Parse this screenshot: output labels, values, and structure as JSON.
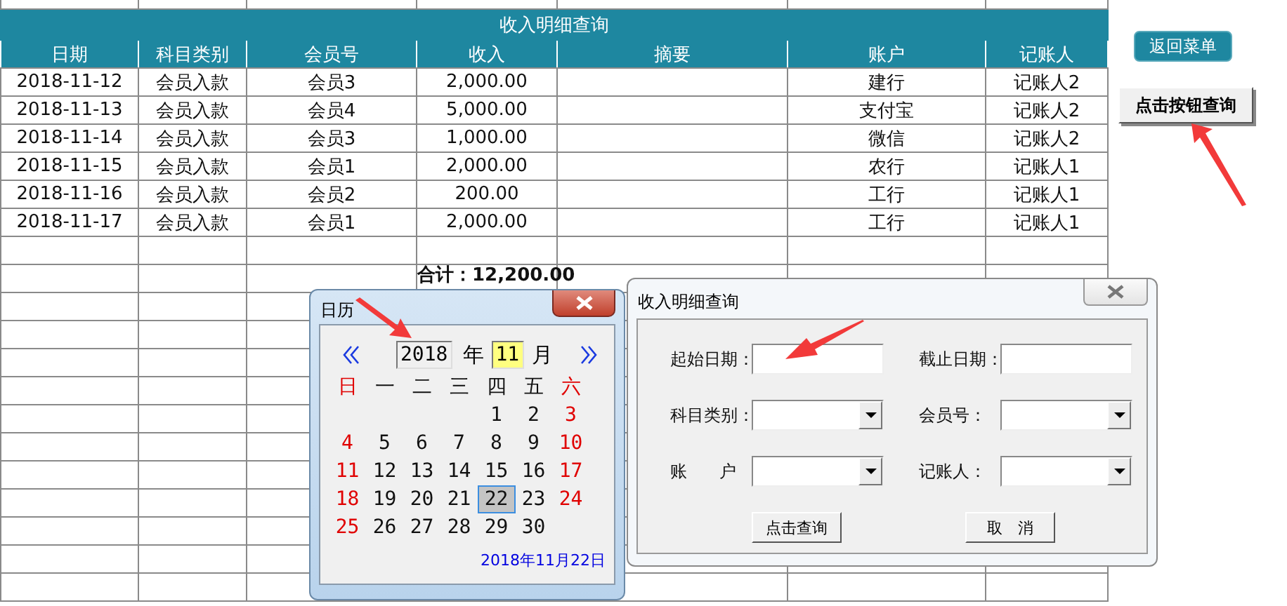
{
  "sheet": {
    "title": "收入明细查询",
    "columns": [
      "日期",
      "科目类别",
      "会员号",
      "收入",
      "摘要",
      "账户",
      "记账人"
    ],
    "rows": [
      [
        "2018-11-12",
        "会员入款",
        "会员3",
        "2,000.00",
        "",
        "建行",
        "记账人2"
      ],
      [
        "2018-11-13",
        "会员入款",
        "会员4",
        "5,000.00",
        "",
        "支付宝",
        "记账人2"
      ],
      [
        "2018-11-14",
        "会员入款",
        "会员3",
        "1,000.00",
        "",
        "微信",
        "记账人2"
      ],
      [
        "2018-11-15",
        "会员入款",
        "会员1",
        "2,000.00",
        "",
        "农行",
        "记账人1"
      ],
      [
        "2018-11-16",
        "会员入款",
        "会员2",
        "200.00",
        "",
        "工行",
        "记账人1"
      ],
      [
        "2018-11-17",
        "会员入款",
        "会员1",
        "2,000.00",
        "",
        "工行",
        "记账人1"
      ]
    ],
    "total": "合计：12,200.00"
  },
  "side_buttons": [
    {
      "label": "返回菜单",
      "kind": "flat"
    },
    {
      "label": "点击按钮查询",
      "kind": "raised"
    }
  ],
  "calendar": {
    "title": "日历",
    "year": "2018",
    "year_unit": "年",
    "month": "11",
    "month_unit": "月",
    "weekdays": [
      {
        "label": "日",
        "weekend": true
      },
      {
        "label": "一",
        "weekend": false
      },
      {
        "label": "二",
        "weekend": false
      },
      {
        "label": "三",
        "weekend": false
      },
      {
        "label": "四",
        "weekend": false
      },
      {
        "label": "五",
        "weekend": false
      },
      {
        "label": "六",
        "weekend": true
      }
    ],
    "days": [
      {
        "day": "1",
        "weekend": false,
        "selected": false
      },
      {
        "day": "2",
        "weekend": false,
        "selected": false
      },
      {
        "day": "3",
        "weekend": true,
        "selected": false
      },
      {
        "day": "4",
        "weekend": true,
        "selected": false
      },
      {
        "day": "5",
        "weekend": false,
        "selected": false
      },
      {
        "day": "6",
        "weekend": false,
        "selected": false
      },
      {
        "day": "7",
        "weekend": false,
        "selected": false
      },
      {
        "day": "8",
        "weekend": false,
        "selected": false
      },
      {
        "day": "9",
        "weekend": false,
        "selected": false
      },
      {
        "day": "10",
        "weekend": true,
        "selected": false
      },
      {
        "day": "11",
        "weekend": true,
        "selected": false
      },
      {
        "day": "12",
        "weekend": false,
        "selected": false
      },
      {
        "day": "13",
        "weekend": false,
        "selected": false
      },
      {
        "day": "14",
        "weekend": false,
        "selected": false
      },
      {
        "day": "15",
        "weekend": false,
        "selected": false
      },
      {
        "day": "16",
        "weekend": false,
        "selected": false
      },
      {
        "day": "17",
        "weekend": true,
        "selected": false
      },
      {
        "day": "18",
        "weekend": true,
        "selected": false
      },
      {
        "day": "19",
        "weekend": false,
        "selected": false
      },
      {
        "day": "20",
        "weekend": false,
        "selected": false
      },
      {
        "day": "21",
        "weekend": false,
        "selected": false
      },
      {
        "day": "22",
        "weekend": false,
        "selected": true
      },
      {
        "day": "23",
        "weekend": false,
        "selected": false
      },
      {
        "day": "24",
        "weekend": true,
        "selected": false
      },
      {
        "day": "25",
        "weekend": true,
        "selected": false
      },
      {
        "day": "26",
        "weekend": false,
        "selected": false
      },
      {
        "day": "27",
        "weekend": false,
        "selected": false
      },
      {
        "day": "28",
        "weekend": false,
        "selected": false
      },
      {
        "day": "29",
        "weekend": false,
        "selected": false
      },
      {
        "day": "30",
        "weekend": false,
        "selected": false
      }
    ],
    "selected_date": "2018年11月22日"
  },
  "query_dialog": {
    "title": "收入明细查询",
    "fields": [
      {
        "label": "起始日期：",
        "kind": "text"
      },
      {
        "label": "截止日期：",
        "kind": "text"
      },
      {
        "label": "科目类别：",
        "kind": "select"
      },
      {
        "label": "会员号：",
        "kind": "select"
      },
      {
        "label": "账      户",
        "kind": "select"
      },
      {
        "label": "记账人：",
        "kind": "select"
      }
    ],
    "buttons": [
      "点击查询",
      "取　消"
    ]
  }
}
